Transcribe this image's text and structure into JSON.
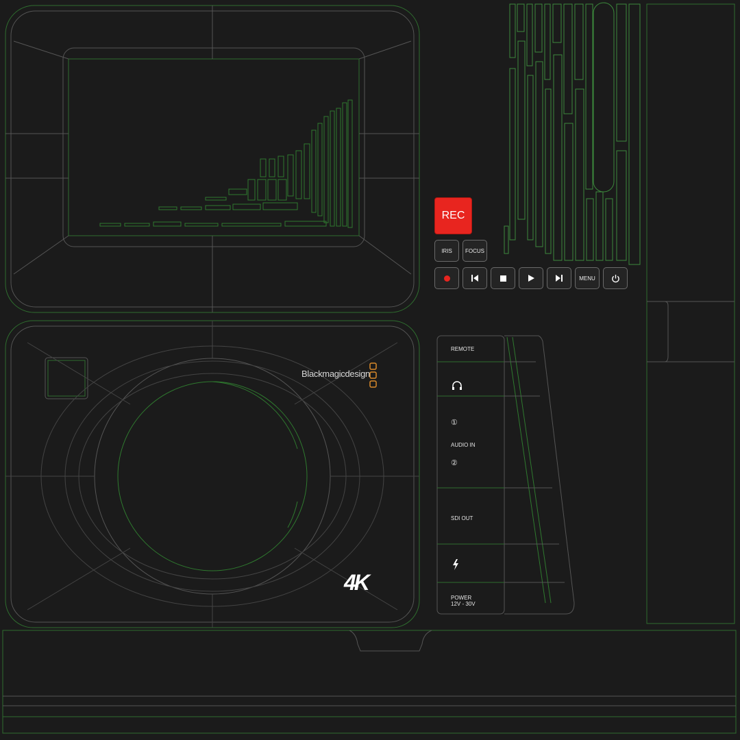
{
  "controls": {
    "rec_label": "REC",
    "iris_label": "IRIS",
    "focus_label": "FOCUS",
    "menu_label": "MENU",
    "transport_icons": [
      "record-dot-icon",
      "skip-back-icon",
      "stop-icon",
      "play-icon",
      "skip-forward-icon"
    ],
    "power_icon": "power-icon"
  },
  "front": {
    "brand": "Blackmagicdesign",
    "badge": "4K"
  },
  "ports": {
    "remote": "REMOTE",
    "headphone_icon": "headphones-icon",
    "channel_1": "①",
    "audio_in": "AUDIO IN",
    "channel_2": "②",
    "sdi_out": "SDI OUT",
    "thunderbolt_icon": "thunderbolt-icon",
    "power_line1": "POWER",
    "power_line2": "12V - 30V"
  },
  "colors": {
    "background": "#1b1b1b",
    "wire_green": "#2f7a2f",
    "wire_grey": "#5a5a5a",
    "rec_red": "#e8251f",
    "brand_orange": "#d98a2b"
  }
}
